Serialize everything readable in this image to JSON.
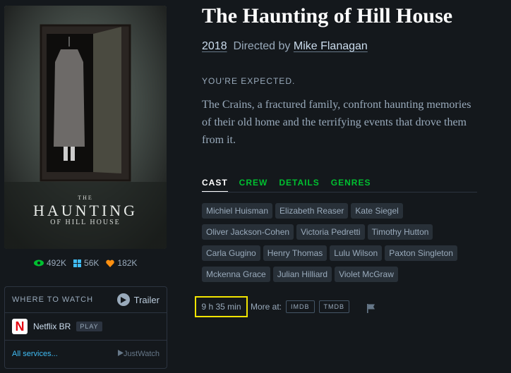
{
  "poster": {
    "small_text": "THE",
    "big_text": "HAUNTING",
    "sub_text": "OF HILL HOUSE"
  },
  "stats": {
    "watches": "492K",
    "lists": "56K",
    "likes": "182K"
  },
  "where_to_watch": {
    "title": "WHERE TO WATCH",
    "trailer_label": "Trailer",
    "service_name": "Netflix BR",
    "play_label": "PLAY",
    "all_services": "All services...",
    "justwatch": "JustWatch"
  },
  "film": {
    "title": "The Haunting of Hill House",
    "year": "2018",
    "directed_by": "Directed by",
    "director": "Mike Flanagan",
    "tagline": "YOU'RE EXPECTED.",
    "synopsis": "The Crains, a fractured family, confront haunting memories of their old home and the terrifying events that drove them from it."
  },
  "tabs": [
    "CAST",
    "CREW",
    "DETAILS",
    "GENRES"
  ],
  "cast": [
    "Michiel Huisman",
    "Elizabeth Reaser",
    "Kate Siegel",
    "Oliver Jackson-Cohen",
    "Victoria Pedretti",
    "Timothy Hutton",
    "Carla Gugino",
    "Henry Thomas",
    "Lulu Wilson",
    "Paxton Singleton",
    "Mckenna Grace",
    "Julian Hilliard",
    "Violet McGraw"
  ],
  "footer": {
    "runtime": "9 h 35 min",
    "more_at": "More at:",
    "imdb": "IMDB",
    "tmdb": "TMDB"
  },
  "colors": {
    "background": "#14181c",
    "accent_green": "#00c030",
    "link_blue": "#40bcf4",
    "highlight_yellow": "#f2e400"
  }
}
